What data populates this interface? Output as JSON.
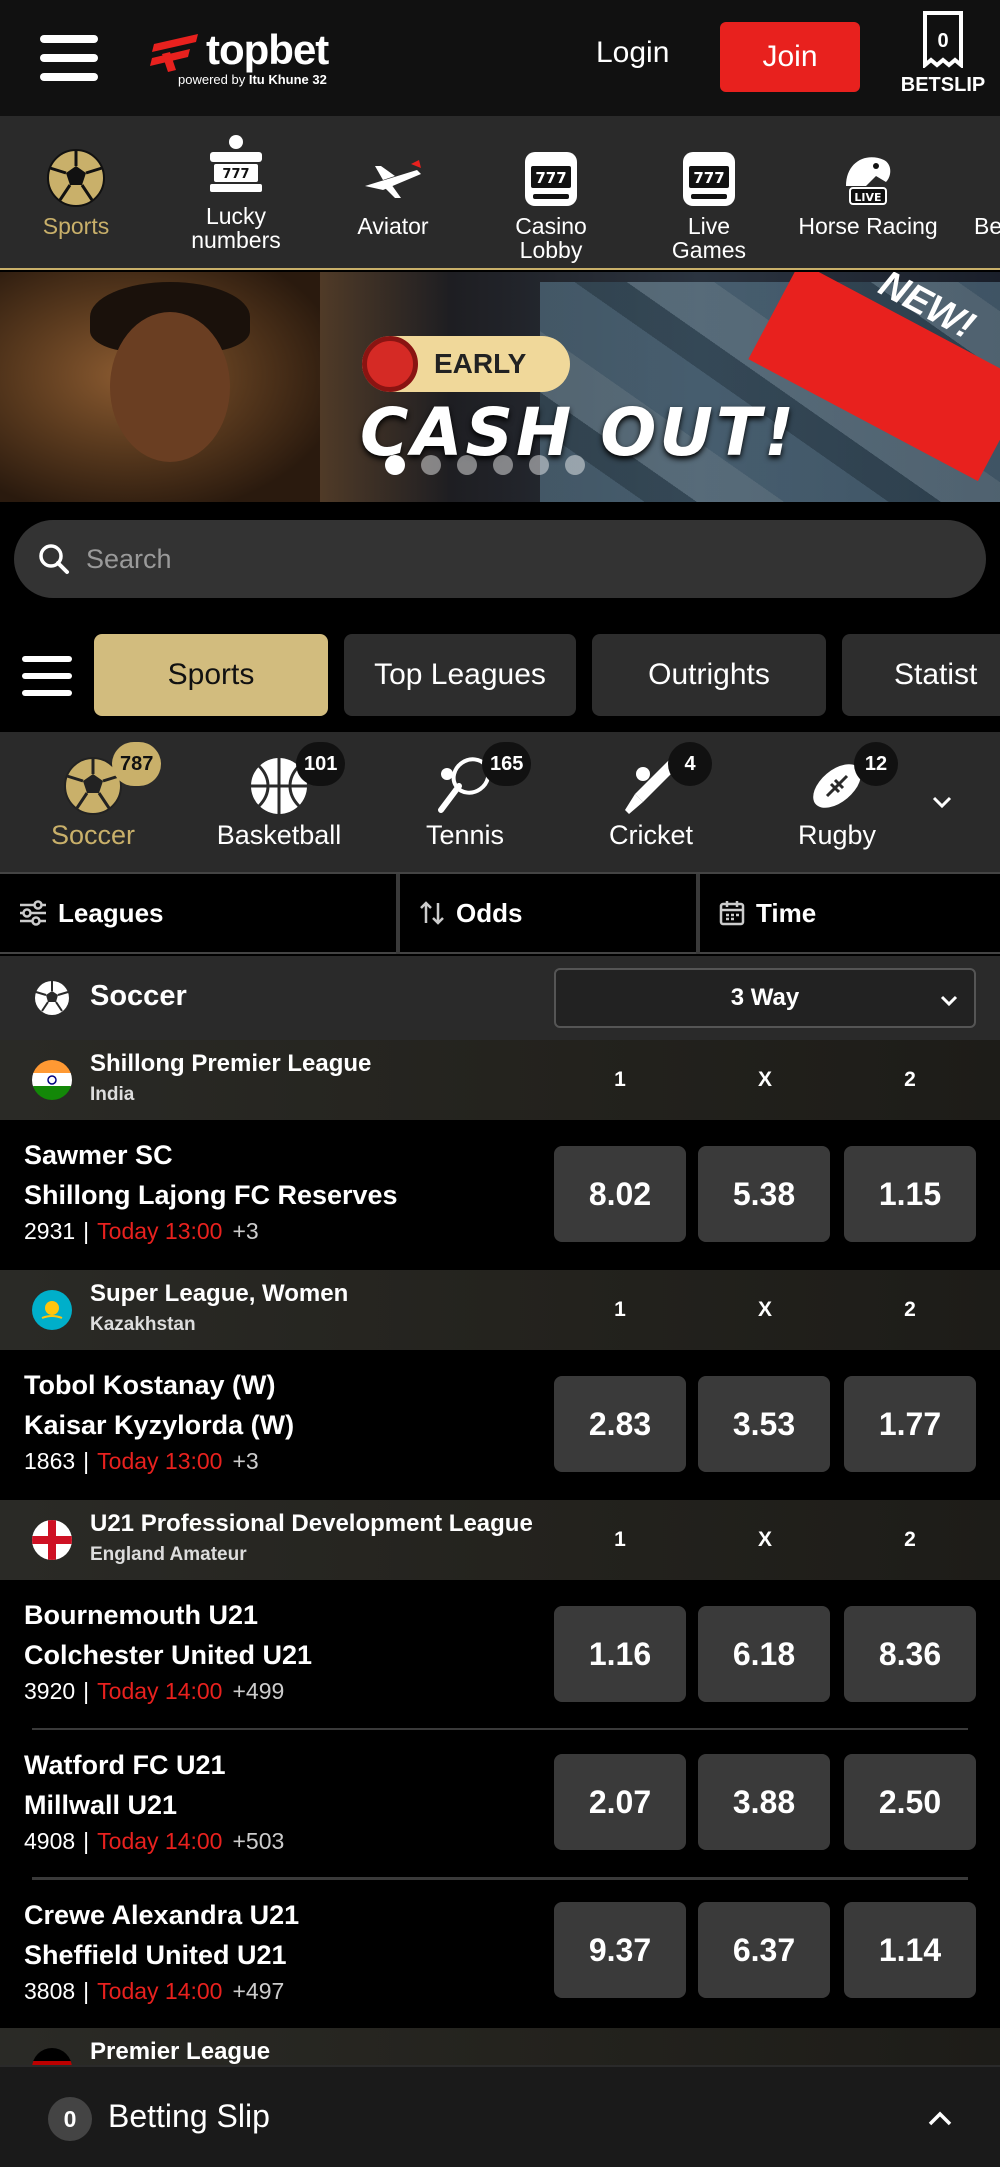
{
  "header": {
    "logo_word": "topbet",
    "logo_powered_by": "powered by",
    "logo_partner": "Itu Khune 32",
    "login_label": "Login",
    "join_label": "Join",
    "betslip_count": "0",
    "betslip_label": "BETSLIP",
    "accent_color": "#e8211e"
  },
  "categories": [
    {
      "label": "Sports",
      "icon": "soccer-ball-icon",
      "active": true
    },
    {
      "label": "Lucky numbers",
      "icon": "lottery-icon"
    },
    {
      "label": "Aviator",
      "icon": "airplane-icon"
    },
    {
      "label": "Casino Lobby",
      "icon": "slot-machine-icon"
    },
    {
      "label": "Live Games",
      "icon": "slot-machine-icon"
    },
    {
      "label": "Horse Racing",
      "icon": "horse-live-icon"
    },
    {
      "label": "Be",
      "icon": ""
    }
  ],
  "banner": {
    "badge": "EARLY",
    "headline": "CASH OUT!",
    "ribbon": "NEW!"
  },
  "search": {
    "placeholder": "Search"
  },
  "tabs": [
    {
      "label": "Sports",
      "active": true
    },
    {
      "label": "Top Leagues"
    },
    {
      "label": "Outrights"
    },
    {
      "label": "Statist"
    }
  ],
  "sports": [
    {
      "name": "Soccer",
      "count": "787",
      "icon": "soccer-ball-icon",
      "active": true
    },
    {
      "name": "Basketball",
      "count": "101",
      "icon": "basketball-icon"
    },
    {
      "name": "Tennis",
      "count": "165",
      "icon": "tennis-icon"
    },
    {
      "name": "Cricket",
      "count": "4",
      "icon": "cricket-icon"
    },
    {
      "name": "Rugby",
      "count": "12",
      "icon": "rugby-ball-icon"
    }
  ],
  "filters": {
    "leagues": "Leagues",
    "odds": "Odds",
    "time": "Time"
  },
  "market": {
    "sport": "Soccer",
    "selected": "3 Way"
  },
  "columns": {
    "c1": "1",
    "cx": "X",
    "c2": "2"
  },
  "leagues": [
    {
      "name": "Shillong Premier League",
      "country": "India",
      "matches": [
        {
          "home": "Sawmer SC",
          "away": "Shillong Lajong FC Reserves",
          "id": "2931",
          "time": "Today 13:00",
          "more": "+3",
          "odds": [
            "8.02",
            "5.38",
            "1.15"
          ]
        }
      ]
    },
    {
      "name": "Super League, Women",
      "country": "Kazakhstan",
      "matches": [
        {
          "home": "Tobol Kostanay (W)",
          "away": "Kaisar Kyzylorda (W)",
          "id": "1863",
          "time": "Today 13:00",
          "more": "+3",
          "odds": [
            "2.83",
            "3.53",
            "1.77"
          ]
        }
      ]
    },
    {
      "name": "U21 Professional Development League",
      "country": "England Amateur",
      "matches": [
        {
          "home": "Bournemouth U21",
          "away": "Colchester United U21",
          "id": "3920",
          "time": "Today 14:00",
          "more": "+499",
          "odds": [
            "1.16",
            "6.18",
            "8.36"
          ]
        },
        {
          "home": "Watford FC U21",
          "away": "Millwall U21",
          "id": "4908",
          "time": "Today 14:00",
          "more": "+503",
          "odds": [
            "2.07",
            "3.88",
            "2.50"
          ]
        },
        {
          "home": "Crewe Alexandra U21",
          "away": "Sheffield United U21",
          "id": "3808",
          "time": "Today 14:00",
          "more": "+497",
          "odds": [
            "9.37",
            "6.37",
            "1.14"
          ]
        }
      ]
    },
    {
      "name": "Premier League",
      "country": "",
      "matches": []
    }
  ],
  "bottom_slip": {
    "count": "0",
    "label": "Betting Slip"
  }
}
